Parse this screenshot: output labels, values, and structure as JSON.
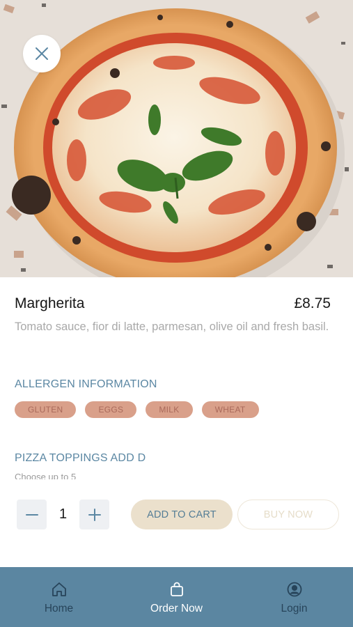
{
  "product": {
    "name": "Margherita",
    "price": "£8.75",
    "description": "Tomato sauce, fior di latte, parmesan, olive oil and fresh basil."
  },
  "allergens": {
    "title": "ALLERGEN INFORMATION",
    "items": [
      "GLUTEN",
      "EGGS",
      "MILK",
      "WHEAT"
    ]
  },
  "toppings": {
    "title": "PIZZA TOPPINGS ADD D",
    "hint": "Choose up to 5"
  },
  "quantity": {
    "value": "1"
  },
  "actions": {
    "add_to_cart": "ADD TO CART",
    "buy_now": "BUY NOW"
  },
  "nav": {
    "items": [
      {
        "label": "Home",
        "icon": "home-icon",
        "active": false
      },
      {
        "label": "Order Now",
        "icon": "bag-icon",
        "active": true
      },
      {
        "label": "Login",
        "icon": "user-circle-icon",
        "active": false
      }
    ]
  },
  "colors": {
    "accent": "#5b87a3",
    "nav_bg": "#5b86a1",
    "chip_bg": "#d9a08a",
    "chip_text": "#a9695a",
    "add_to_cart_bg": "#ebe0cc"
  },
  "icons": {
    "close": "close-icon",
    "minus": "minus-icon",
    "plus": "plus-icon"
  }
}
